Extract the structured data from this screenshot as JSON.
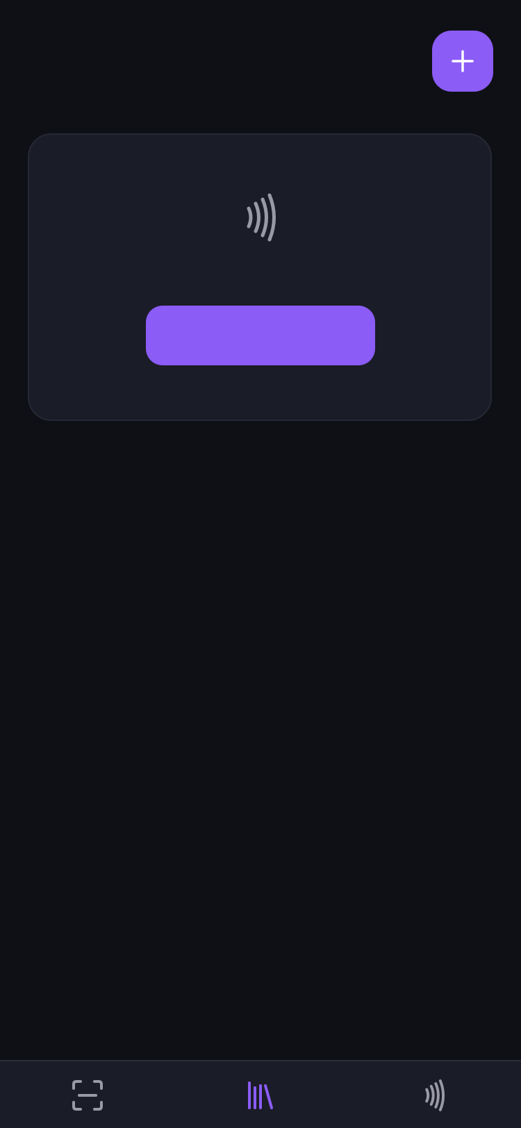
{
  "header": {
    "add_button": {
      "icon": "plus-icon"
    }
  },
  "card": {
    "icon": "nfc-waves-icon",
    "primary_button_label": ""
  },
  "bottom_nav": {
    "items": [
      {
        "id": "scan",
        "icon": "scan-frame-icon",
        "active": false
      },
      {
        "id": "library",
        "icon": "library-icon",
        "active": true
      },
      {
        "id": "nfc",
        "icon": "nfc-waves-icon",
        "active": false
      }
    ]
  },
  "colors": {
    "background": "#0f1015",
    "surface": "#1a1c27",
    "accent": "#8b5cf6",
    "icon_inactive": "#9a9aa6"
  }
}
